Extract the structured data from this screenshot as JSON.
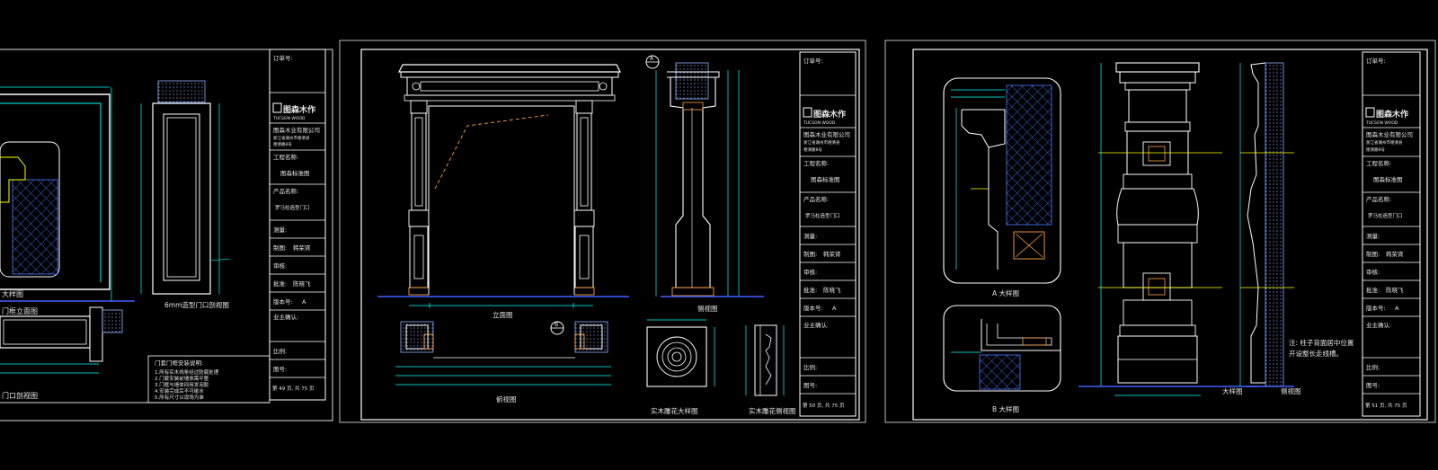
{
  "sheets": [
    {
      "title_block": {
        "order_no_label": "订单号:",
        "brand_cn": "图森木作",
        "brand_en": "TUCSON WOOD",
        "company": "图森木业有限公司",
        "company_sub": "浙江省湖州市德清县",
        "company_sub2": "德清路8号",
        "project_label": "工程名称:",
        "project_value": "图森标准图",
        "product_label": "产品名称:",
        "product_value": "罗马柱造型门口",
        "measure_label": "测量:",
        "draw_label": "制图:",
        "draw_value": "韩荣宵",
        "review_label": "审核:",
        "approve_label": "批准:",
        "approve_value": "陈晓飞",
        "version_label": "版本号:",
        "version_value": "A",
        "owner_label": "业主确认:",
        "scale_label": "比例:",
        "drawing_no_label": "图号:",
        "page_text": "第 49 页, 共 75 页"
      },
      "captions": [
        "大样图",
        "门框立面图",
        "6mm造型门口剖视图",
        "门口剖视图"
      ],
      "notes_title": "门套门框安装说明:",
      "notes": [
        "1.所有实木线条经过防腐处理",
        "2.门套安装前墙体需平整",
        "3.门框与墙体间用发泡胶",
        "4.安装完成后不可碰水",
        "5.所有尺寸以现场为准"
      ]
    },
    {
      "title_block": {
        "order_no_label": "订单号:",
        "brand_cn": "图森木作",
        "brand_en": "TUCSON WOOD",
        "company": "图森木业有限公司",
        "company_sub": "浙江省湖州市德清县",
        "company_sub2": "德清路8号",
        "project_label": "工程名称:",
        "project_value": "图森标准图",
        "product_label": "产品名称:",
        "product_value": "罗马柱造型门口",
        "measure_label": "测量:",
        "draw_label": "制图:",
        "draw_value": "韩荣宵",
        "review_label": "审核:",
        "approve_label": "批准:",
        "approve_value": "陈晓飞",
        "version_label": "版本号:",
        "version_value": "A",
        "owner_label": "业主确认:",
        "scale_label": "比例:",
        "drawing_no_label": "图号:",
        "page_text": "第 50 页, 共 75 页"
      },
      "captions": [
        "立面图",
        "侧视图",
        "俯视图",
        "实木雕花大样图",
        "实木雕花侧视图"
      ]
    },
    {
      "title_block": {
        "order_no_label": "订单号:",
        "brand_cn": "图森木作",
        "brand_en": "TUCSON WOOD",
        "company": "图森木业有限公司",
        "company_sub": "浙江省湖州市德清县",
        "company_sub2": "德清路8号",
        "project_label": "工程名称:",
        "project_value": "图森标准图",
        "product_label": "产品名称:",
        "product_value": "罗马柱造型门口",
        "measure_label": "测量:",
        "draw_label": "制图:",
        "draw_value": "韩荣宵",
        "review_label": "审核:",
        "approve_label": "批准:",
        "approve_value": "陈晓飞",
        "version_label": "版本号:",
        "version_value": "A",
        "owner_label": "业主确认:",
        "scale_label": "比例:",
        "drawing_no_label": "图号:",
        "page_text": "第 51 页, 共 75 页"
      },
      "captions": [
        "A 大样图",
        "B 大样图",
        "大样图",
        "侧视图"
      ],
      "note_line1": "注: 柱子背面居中位置",
      "note_line2": "开设整长走线槽。"
    }
  ],
  "callouts": {
    "a": "A",
    "b": "B"
  },
  "colors": {
    "background": "#000000",
    "frame": "#ffffff",
    "cyan": "#00ffff",
    "blue": "#3f5fff",
    "yellow": "#ffff00",
    "orange": "#ff9f40",
    "magenta": "#ff00ff",
    "green": "#00ff00"
  }
}
